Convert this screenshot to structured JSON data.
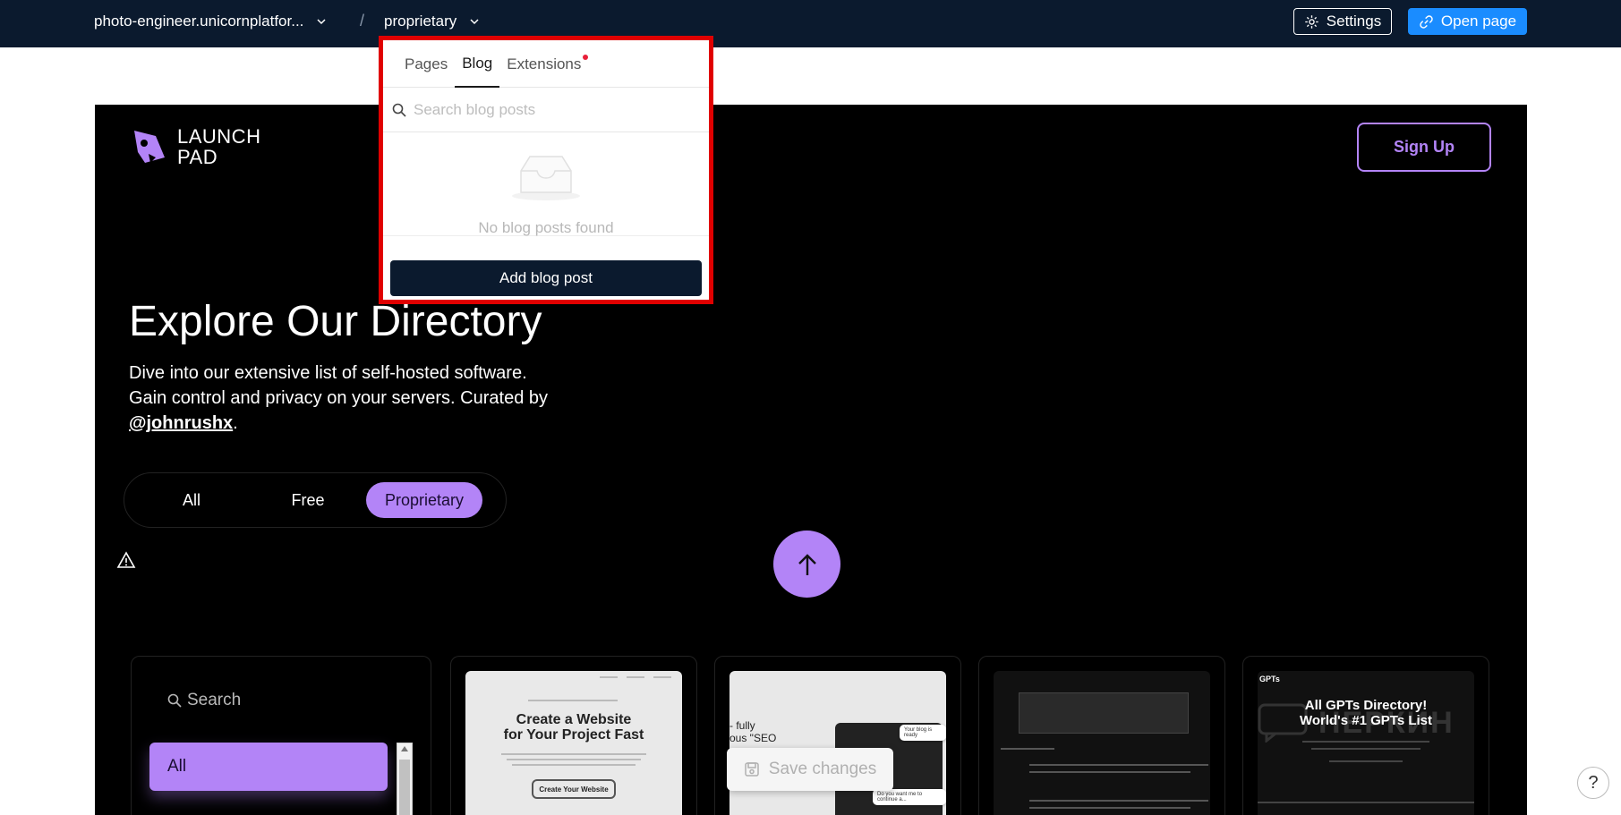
{
  "topbar": {
    "site_name": "photo-engineer.unicornplatfor...",
    "separator": "/",
    "page_name": "proprietary",
    "settings_label": "Settings",
    "open_page_label": "Open page"
  },
  "dropdown": {
    "tabs": [
      {
        "label": "Pages",
        "active": false
      },
      {
        "label": "Blog",
        "active": true
      },
      {
        "label": "Extensions",
        "active": false,
        "notification": true
      }
    ],
    "search_placeholder": "Search blog posts",
    "empty_message": "No blog posts found",
    "add_button_label": "Add blog post"
  },
  "site": {
    "logo_line1": "LAUNCH",
    "logo_line2": "PAD",
    "signup_label": "Sign Up",
    "hero_title": "Explore Our Directory",
    "hero_desc_line1": "Dive into our extensive list of self-hosted software.",
    "hero_desc_line2": "Gain control and privacy on your servers. Curated by",
    "hero_handle": "@johnrushx",
    "hero_desc_end": ".",
    "filters": [
      {
        "label": "All",
        "active": false
      },
      {
        "label": "Free",
        "active": false
      },
      {
        "label": "Proprietary",
        "active": true
      }
    ],
    "sidebar": {
      "search_label": "Search",
      "active_category": "All"
    },
    "cards": [
      {
        "headline_line1": "Create a Website",
        "headline_line2": "for Your Project Fast",
        "cta": "Create Your Website"
      },
      {
        "text_line1": "- fully",
        "text_line2": "ous \"SEO",
        "bubble1": "Your blog is ready",
        "bubble2": "Do you want me to continue a..."
      },
      {},
      {
        "headline_line1": "All GPTs Directory!",
        "headline_line2": "World's #1 GPTs List",
        "prefix": "GPTs"
      }
    ],
    "accent_color": "#b384f7"
  },
  "save_changes_label": "Save changes",
  "watermark_text": "НЕРКИН",
  "help_label": "?"
}
